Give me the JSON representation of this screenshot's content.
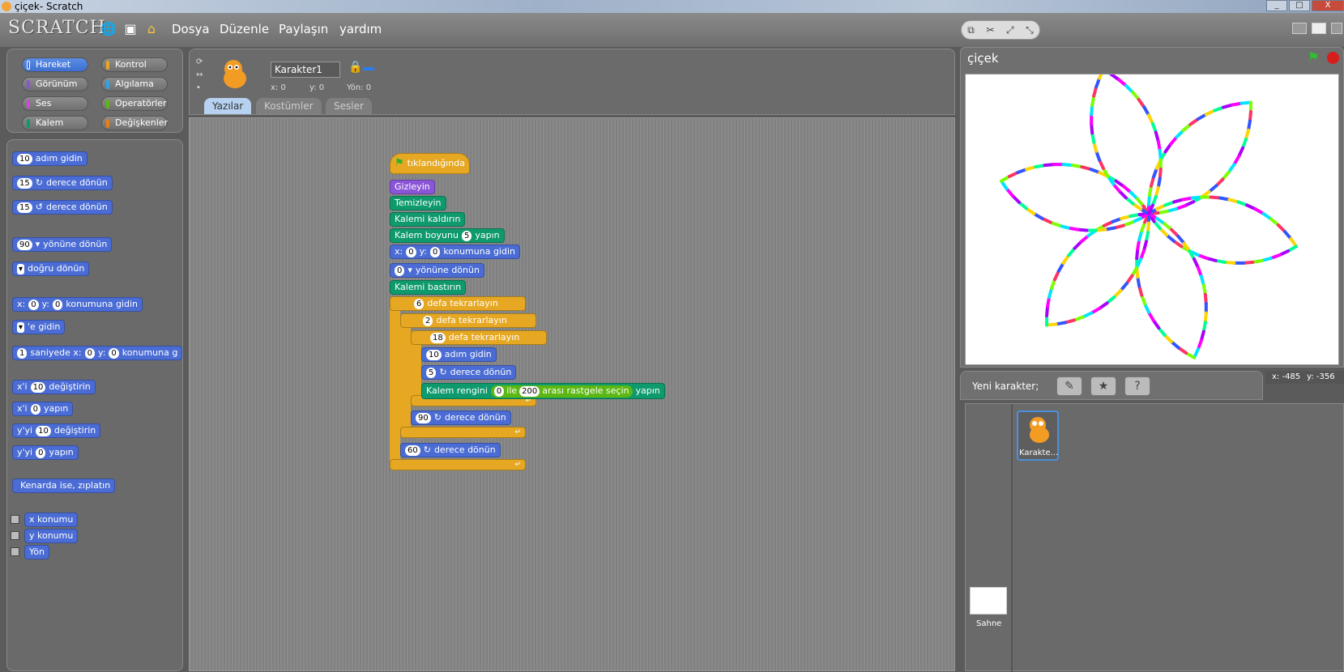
{
  "window": {
    "title": "çiçek- Scratch",
    "min": "_",
    "max": "□",
    "close": "X"
  },
  "menu": {
    "logo": "SCRATCH",
    "file": "Dosya",
    "edit": "Düzenle",
    "share": "Paylaşın",
    "help": "yardım"
  },
  "categories": [
    {
      "label": "Hareket",
      "color": "#4a6cd4"
    },
    {
      "label": "Kontrol",
      "color": "#e6a822"
    },
    {
      "label": "Görünüm",
      "color": "#8a55d7"
    },
    {
      "label": "Algılama",
      "color": "#2ca5e2"
    },
    {
      "label": "Ses",
      "color": "#cf4ad9"
    },
    {
      "label": "Operatörler",
      "color": "#5cb712"
    },
    {
      "label": "Kalem",
      "color": "#0e9a6c"
    },
    {
      "label": "Değişkenler",
      "color": "#ee7d16"
    }
  ],
  "palette": {
    "move_steps": {
      "n": "10",
      "label": "adım gidin"
    },
    "turn_right": {
      "n": "15",
      "label": "derece dönün"
    },
    "turn_left": {
      "n": "15",
      "label": "derece dönün"
    },
    "point_dir": {
      "n": "90",
      "label": "yönüne dönün"
    },
    "point_towards": {
      "label": "doğru dönün"
    },
    "goto_xy": {
      "x": "x:",
      "xv": "0",
      "y": "y:",
      "yv": "0",
      "label": "konumuna gidin"
    },
    "goto": {
      "label": "'e gidin"
    },
    "glide": {
      "n": "1",
      "a": "saniyede x:",
      "xv": "0",
      "b": "y:",
      "yv": "0",
      "label": "konumuna g"
    },
    "change_x": {
      "a": "x'i",
      "n": "10",
      "label": "değiştirin"
    },
    "set_x": {
      "a": "x'i",
      "n": "0",
      "label": "yapın"
    },
    "change_y": {
      "a": "y'yi",
      "n": "10",
      "label": "değiştirin"
    },
    "set_y": {
      "a": "y'yi",
      "n": "0",
      "label": "yapın"
    },
    "bounce": {
      "label": "Kenarda ise, zıplatın"
    },
    "xpos": "x konumu",
    "ypos": "y konumu",
    "dir": "Yön"
  },
  "sprite": {
    "name": "Karakter1",
    "x": "x: 0",
    "y": "y: 0",
    "dir": "Yön: 0"
  },
  "tabs": [
    "Yazılar",
    "Kostümler",
    "Sesler"
  ],
  "script": {
    "hat": "tıklandığında",
    "hide": "Gizleyin",
    "clear": "Temizleyin",
    "penup": "Kalemi kaldırın",
    "pensize": {
      "a": "Kalem boyunu",
      "n": "5",
      "b": "yapın"
    },
    "gotoxy": {
      "a": "x:",
      "xv": "0",
      "b": "y:",
      "yv": "0",
      "c": "konumuna gidin"
    },
    "pointdir": {
      "n": "0",
      "label": "yönüne dönün"
    },
    "pendown": "Kalemi bastırın",
    "rep1": {
      "n": "6",
      "label": "defa tekrarlayın"
    },
    "rep2": {
      "n": "2",
      "label": "defa tekrarlayın"
    },
    "rep3": {
      "n": "18",
      "label": "defa tekrarlayın"
    },
    "move": {
      "n": "10",
      "label": "adım gidin"
    },
    "turn5": {
      "n": "5",
      "label": "derece dönün"
    },
    "pencolor": {
      "a": "Kalem rengini",
      "n1": "0",
      "b": "ile",
      "n2": "200",
      "c": "arası rastgele seçin",
      "d": "yapın"
    },
    "turn90": {
      "n": "90",
      "label": "derece dönün"
    },
    "turn60": {
      "n": "60",
      "label": "derece dönün"
    }
  },
  "stage": {
    "title": "çiçek",
    "coords_x": "x: -485",
    "coords_y": "y: -356"
  },
  "sprites_panel": {
    "new_sprite": "Yeni karakter;",
    "sprite_label": "Karakte...",
    "stage_label": "Sahne"
  }
}
